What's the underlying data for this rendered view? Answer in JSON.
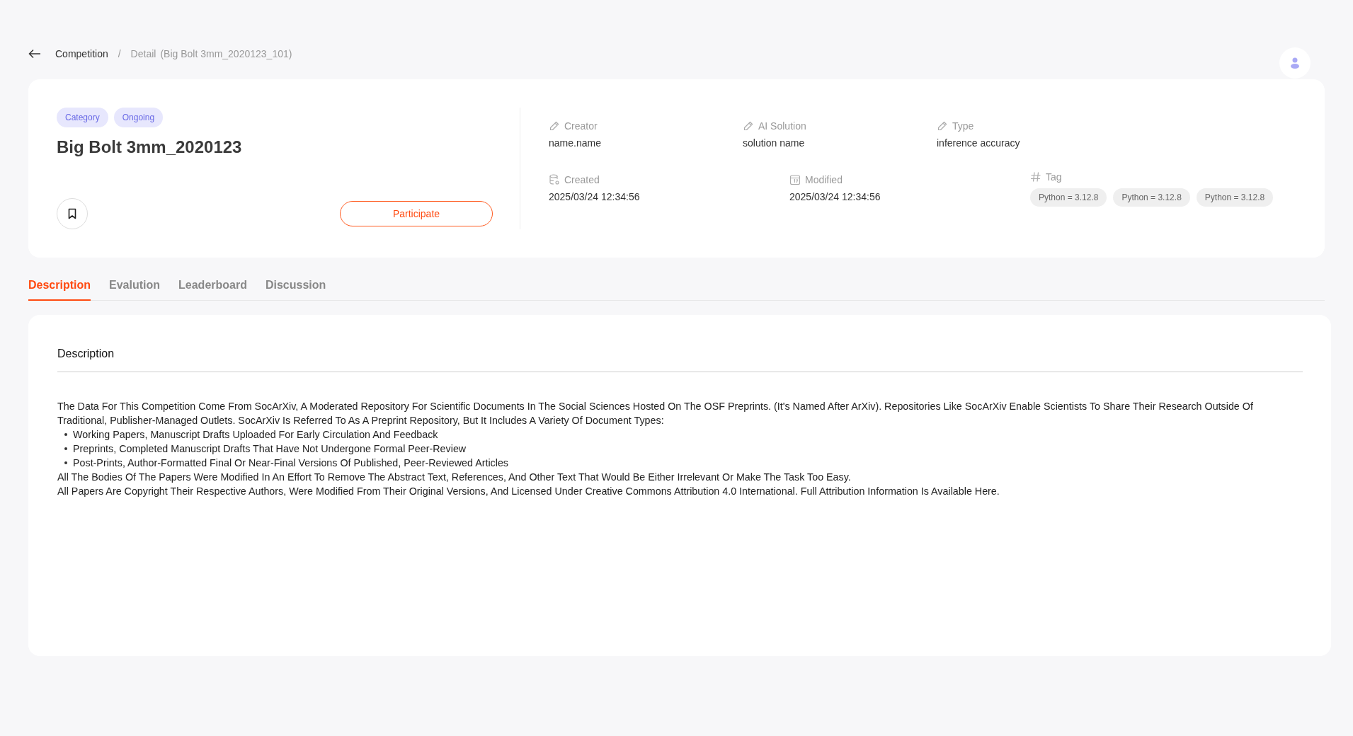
{
  "breadcrumb": {
    "parent": "Competition",
    "separator": "/",
    "current": "Detail",
    "detail": "(Big Bolt 3mm_2020123_101)"
  },
  "header": {
    "badges": [
      "Category",
      "Ongoing"
    ],
    "title": "Big Bolt 3mm_2020123",
    "bookmarked": false,
    "action": "Participate"
  },
  "meta_top": [
    {
      "label": "Creator",
      "value": "name.name"
    },
    {
      "label": "AI Solution",
      "value": "solution name"
    },
    {
      "label": "Type",
      "value": "inference  accuracy"
    }
  ],
  "meta_bottom": [
    {
      "kind": "created",
      "label": "Created",
      "value": "2025/03/24 12:34:56"
    },
    {
      "kind": "modified",
      "label": "Modified",
      "value": "2025/03/24 12:34:56"
    }
  ],
  "tag": {
    "label": "Tag",
    "chips": [
      "Python = 3.12.8",
      "Python = 3.12.8",
      "Python = 3.12.8"
    ]
  },
  "tabs": [
    {
      "label": "Description",
      "selected": true
    },
    {
      "label": "Evalution",
      "selected": false
    },
    {
      "label": "Leaderboard",
      "selected": false
    },
    {
      "label": "Discussion",
      "selected": false
    }
  ],
  "description": {
    "heading": "Description",
    "intro": "The Data For This Competition Come From SocArXiv, A Moderated Repository For Scientific Documents In The Social Sciences Hosted On The OSF Preprints. (It's Named After ArXiv). Repositories Like SocArXiv Enable Scientists To Share Their Research Outside Of Traditional, Publisher-Managed Outlets. SocArXiv Is Referred To As A Preprint Repository, But It Includes A Variety Of Document Types:",
    "bullets": [
      "Working Papers, Manuscript Drafts Uploaded For Early Circulation And Feedback",
      "Preprints, Completed Manuscript Drafts That Have Not Undergone Formal Peer-Review",
      "Post-Prints, Author-Formatted Final Or Near-Final Versions Of Published, Peer-Reviewed Articles"
    ],
    "paragraphs": [
      "All The Bodies Of The Papers Were Modified In An Effort To Remove The Abstract Text, References, And Other Text That Would Be Either Irrelevant Or Make The Task Too Easy.",
      "All Papers Are Copyright Their Respective Authors, Were Modified From Their Original Versions, And Licensed Under Creative Commons Attribution 4.0 International. Full Attribution Information Is Available Here."
    ]
  }
}
